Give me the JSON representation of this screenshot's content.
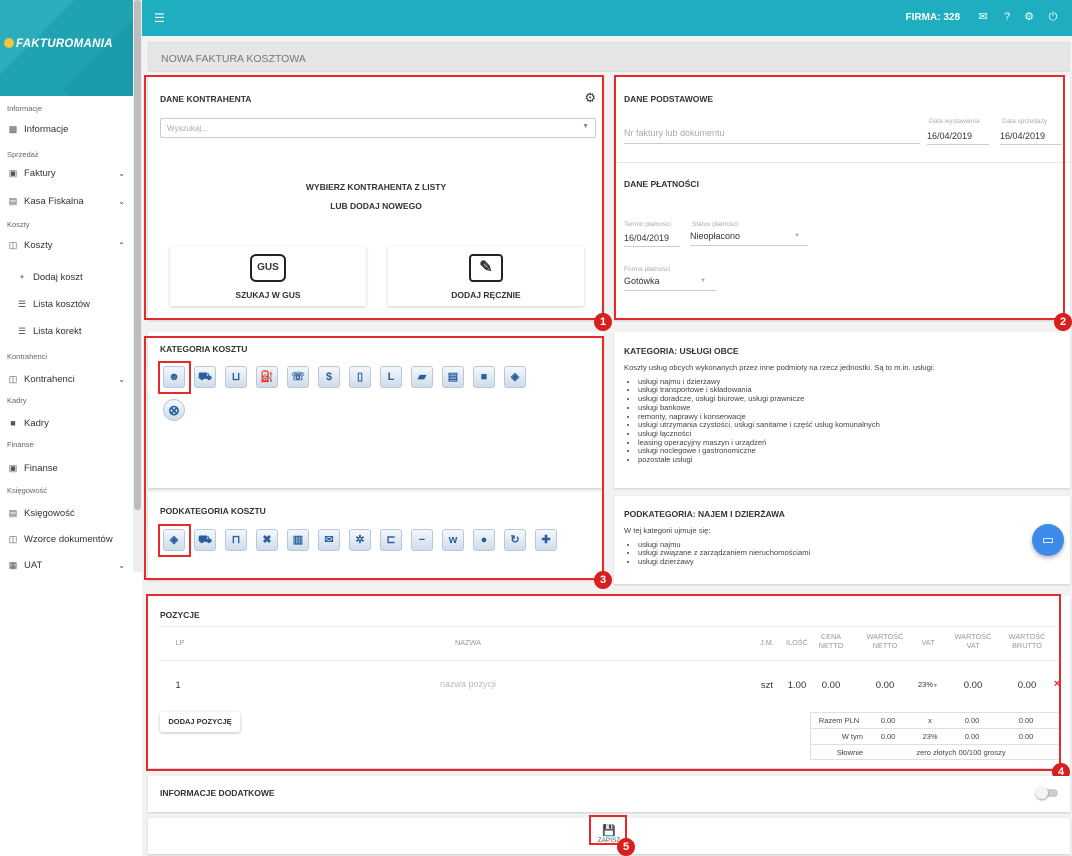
{
  "brand": {
    "logo_text": "FAKTUROMANIA"
  },
  "topbar": {
    "firma": "FIRMA: 328"
  },
  "sidebar": {
    "sec_informacje": "Informacje",
    "informacje": "Informacje",
    "sec_sprzedaz": "Sprzedaż",
    "faktury": "Faktury",
    "kasa_fiskalna": "Kasa Fiskalna",
    "sec_koszty": "Koszty",
    "koszty": "Koszty",
    "dodaj_koszt": "Dodaj koszt",
    "lista_kosztow": "Lista kosztów",
    "lista_korekt": "Lista korekt",
    "sec_kontrahenci": "Kontrahenci",
    "kontrahenci": "Kontrahenci",
    "sec_kadry": "Kadry",
    "kadry": "Kadry",
    "sec_finanse": "Finanse",
    "finanse": "Finanse",
    "sec_ksiegowosc": "Księgowość",
    "ksiegowosc": "Księgowość",
    "wzorce": "Wzorce dokumentów",
    "uat": "UAT"
  },
  "page_title": "NOWA FAKTURA KOSZTOWA",
  "kontrahent": {
    "title": "DANE KONTRAHENTA",
    "search_placeholder": "Wyszukaj...",
    "prompt_line1": "WYBIERZ KONTRAHENTA Z LISTY",
    "prompt_line2": "LUB DODAJ NOWEGO",
    "gus_label": "SZUKAJ W GUS",
    "gus_logo": "GUS",
    "manual_label": "DODAJ RĘCZNIE"
  },
  "podstawowe": {
    "title": "DANE PODSTAWOWE",
    "nr_placeholder": "Nr faktury lub dokumentu",
    "data_wystawienia_label": "Data wystawienia",
    "data_wystawienia": "16/04/2019",
    "data_sprzedazy_label": "Data sprzedaży",
    "data_sprzedazy": "16/04/2019"
  },
  "platnosci": {
    "title": "DANE PŁATNOŚCI",
    "termin_label": "Termin płatności",
    "termin": "16/04/2019",
    "status_label": "Status płatności",
    "status": "Nieopłacono",
    "forma_label": "Forma płatności",
    "forma": "Gotówka"
  },
  "kategoria": {
    "title": "KATEGORIA KOSZTU",
    "icons": [
      "person-icon",
      "car-icon",
      "cart-icon",
      "fuel-icon",
      "phone-plug-icon",
      "dollar-icon",
      "mobile-icon",
      "l-icon",
      "ticket-icon",
      "register-icon",
      "folder-icon",
      "box-icon",
      "cancel-icon"
    ]
  },
  "podkategoria": {
    "title": "PODKATEGORIA KOSZTU",
    "icons": [
      "box-icon",
      "truck-icon",
      "desk-icon",
      "tools-icon",
      "trash-icon",
      "mail-icon",
      "gears-icon",
      "bed-icon",
      "minus-icon",
      "www-icon",
      "globe-icon",
      "refresh-icon",
      "plus-icon"
    ]
  },
  "kategoria_info": {
    "title": "KATEGORIA: USŁUGI OBCE",
    "intro": "Koszty usług obcych wykonanych przez inne podmioty na rzecz jednostki. Są to m.in. usługi:",
    "items": [
      "usługi najmu i dzierżawy",
      "usługi transportowe i składowania",
      "usługi doradcze, usługi biurowe, usługi prawnicze",
      "usługi bankowe",
      "remonty, naprawy i konserwacje",
      "usługi utrzymania czystości, usługi sanitarne i część usług komunalnych",
      "usługi łączności",
      "leasing operacyjny maszyn i urządzeń",
      "usługi noclegowe i gastronomiczne",
      "pozostałe usługi"
    ]
  },
  "podkategoria_info": {
    "title": "PODKATEGORIA: NAJEM I DZIERŻAWA",
    "intro": "W tej kategorii ujmuje się:",
    "items": [
      "usługi najmu",
      "usługi związane z zarządzaniem nieruchomościami",
      "usługi dzierżawy"
    ]
  },
  "pozycje": {
    "title": "POZYCJE",
    "headers": {
      "lp": "LP",
      "nazwa": "NAZWA",
      "jm": "J.M.",
      "ilosc": "ILOŚĆ",
      "cena_netto": "CENA NETTO",
      "wartosc_netto": "WARTOŚĆ NETTO",
      "vat": "VAT",
      "wartosc_vat": "WARTOŚĆ VAT",
      "wartosc_brutto": "WARTOŚĆ BRUTTO"
    },
    "row": {
      "lp": "1",
      "nazwa_placeholder": "nazwa pozycji",
      "jm": "szt",
      "ilosc": "1.00",
      "cena_netto": "0.00",
      "wartosc_netto": "0.00",
      "vat": "23%",
      "wartosc_vat": "0.00",
      "wartosc_brutto": "0.00",
      "delete": "×"
    },
    "add_label": "DODAJ POZYCJĘ",
    "summary": {
      "razem_label": "Razem PLN",
      "razem_netto": "0.00",
      "razem_vat_rate": "x",
      "razem_vat": "0.00",
      "razem_brutto": "0.00",
      "wtym_label": "W tym",
      "wtym_netto": "0.00",
      "wtym_vat_rate": "23%",
      "wtym_vat": "0.00",
      "wtym_brutto": "0.00",
      "slownie_label": "Słownie",
      "slownie_value": "zero złotych 00/100 groszy"
    }
  },
  "info_dodatkowe": {
    "title": "INFORMACJE DODATKOWE"
  },
  "save": {
    "label": "ZAPISZ"
  },
  "badges": [
    "1",
    "2",
    "3",
    "4",
    "5"
  ],
  "colors": {
    "accent": "#1eaebf",
    "highlight": "#e52a2a",
    "chat": "#3d8be8"
  }
}
